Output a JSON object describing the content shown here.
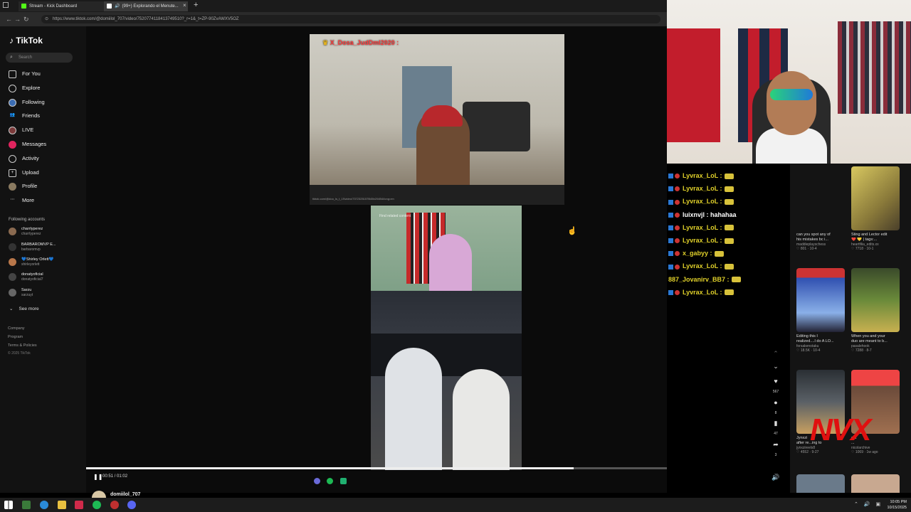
{
  "browser": {
    "tabs": [
      {
        "label": "Stream - Kick Dashboard",
        "color": "#53fc18"
      },
      {
        "label": "(99+) Explorando el Menute...",
        "color": "#ffffff"
      }
    ],
    "new_tab": "+",
    "url": "https://www.tiktok.com/@domiilol_707/video/7520774118413749510?_r=1&_t=ZP-90ZvAWXV5OZ"
  },
  "tiktok": {
    "brand": "TikTok",
    "search_placeholder": "Search",
    "nav": [
      {
        "label": "For You",
        "icon": "home-icon"
      },
      {
        "label": "Explore",
        "icon": "compass-icon"
      },
      {
        "label": "Following",
        "icon": "following-icon"
      },
      {
        "label": "Friends",
        "icon": "friends-icon"
      },
      {
        "label": "LIVE",
        "icon": "live-icon"
      },
      {
        "label": "Messages",
        "icon": "message-icon"
      },
      {
        "label": "Activity",
        "icon": "activity-icon"
      },
      {
        "label": "Upload",
        "icon": "upload-icon"
      },
      {
        "label": "Profile",
        "icon": "profile-icon"
      },
      {
        "label": "More",
        "icon": "more-icon"
      }
    ],
    "following_title": "Following accounts",
    "accounts": [
      {
        "name": "charrlyperez",
        "handle": "charrlyperez",
        "color": "#8a6a50"
      },
      {
        "name": "BARBAROMVP E...",
        "handle": "barbaromvp",
        "color": "#333333"
      },
      {
        "name": "💙Shirley Orlett💙",
        "handle": "shirleyorlett",
        "color": "#b9774a"
      },
      {
        "name": "donatyoficial",
        "handle": "donatyoficial7",
        "color": "#444444"
      },
      {
        "name": "Sarzu",
        "handle": "sarzuyt",
        "color": "#666666"
      }
    ],
    "see_more": "See more",
    "footer": [
      "Company",
      "Program",
      "Terms & Policies",
      "© 2025 TikTok"
    ]
  },
  "video": {
    "overlay_name": "X_Dosa_JudDml2020 :",
    "strip_url": "tiktok.com/@doo_ls_t_1Svideo/7372325157B45b204B4/long=en",
    "find_text": "Find related content",
    "time": "00:51 / 01:02",
    "progress": 0.84,
    "author": "domiilol_707"
  },
  "actions": {
    "likes": "567",
    "comments": "8",
    "saves": "47",
    "shares": "3"
  },
  "chat": [
    {
      "user": "Lyvrax_LoL :",
      "msg": "",
      "color": "#e0d02a"
    },
    {
      "user": "Lyvrax_LoL :",
      "msg": "",
      "color": "#e0d02a"
    },
    {
      "user": "Lyvrax_LoL :",
      "msg": "",
      "color": "#e0d02a"
    },
    {
      "user": "luixnvjl : hahahaa",
      "msg": "",
      "color": "#ffffff"
    },
    {
      "user": "Lyvrax_LoL :",
      "msg": "",
      "color": "#e0d02a"
    },
    {
      "user": "Lyvrax_LoL :",
      "msg": "",
      "color": "#e0d02a"
    },
    {
      "user": "x_gabyy :",
      "msg": "",
      "color": "#e0d02a"
    },
    {
      "user": "Lyvrax_LoL :",
      "msg": "",
      "color": "#e0d02a"
    },
    {
      "user": "887_Jovanirv_BB7 :",
      "msg": "",
      "color": "#e0d02a"
    },
    {
      "user": "Lyvrax_LoL :",
      "msg": "",
      "color": "#e0d02a"
    }
  ],
  "feed": [
    {
      "title": "can you spot any of",
      "title2": "his mistakes bc i...",
      "author": "maddieplayschess",
      "meta": "♡ 801 · 10-4",
      "color": "#8a9aa6"
    },
    {
      "title": "Sting and Lector edit",
      "title2": "❤️ 💛 | tags:...",
      "author": "heartfilia_edits.xx",
      "meta": "♡ 7718 · 10-1",
      "color": "#b8a648"
    },
    {
      "title": "Editing this I",
      "title2": "realized....I do A LO...",
      "author": "forsakenotaku",
      "meta": "♡ 18.5K · 10-4",
      "color": "#3158b8"
    },
    {
      "title": "When you and your",
      "title2": "duo are meant to b...",
      "author": "pasalehook",
      "meta": "♡ 7288 · 8-7",
      "color": "#5b7a3a"
    },
    {
      "title": "Jynxzi",
      "title2": "after re...ing to",
      "author": "jynxzireels8",
      "meta": "♡ 4552 · 9-27",
      "color": "#3a3f44"
    },
    {
      "title": "est",
      "title2": "...",
      "author": "nicolarchive",
      "meta": "♡ 1069 · 1w ago",
      "color": "#6a4a3a"
    }
  ],
  "watermark": "NVX",
  "taskbar": {
    "time": "10:05 PM",
    "date": "10/15/2025"
  }
}
